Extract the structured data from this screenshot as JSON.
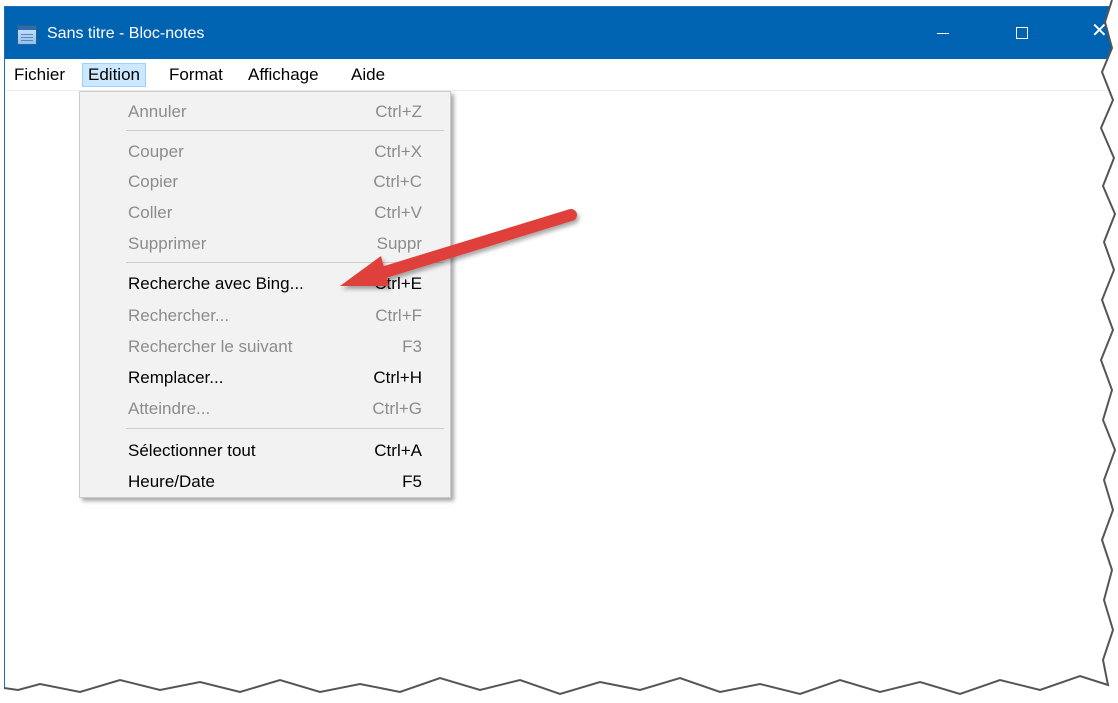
{
  "window": {
    "title": "Sans titre - Bloc-notes",
    "close_glyph": "✕"
  },
  "menubar": {
    "items": [
      {
        "label": "Fichier"
      },
      {
        "label": "Edition",
        "active": true
      },
      {
        "label": "Format"
      },
      {
        "label": "Affichage"
      },
      {
        "label": "Aide"
      }
    ]
  },
  "edit_menu": {
    "items": [
      {
        "label": "Annuler",
        "shortcut": "Ctrl+Z",
        "enabled": false
      },
      {
        "label": "Couper",
        "shortcut": "Ctrl+X",
        "enabled": false
      },
      {
        "label": "Copier",
        "shortcut": "Ctrl+C",
        "enabled": false
      },
      {
        "label": "Coller",
        "shortcut": "Ctrl+V",
        "enabled": false
      },
      {
        "label": "Supprimer",
        "shortcut": "Suppr",
        "enabled": false
      },
      {
        "label": "Recherche avec Bing...",
        "shortcut": "Ctrl+E",
        "enabled": true
      },
      {
        "label": "Rechercher...",
        "shortcut": "Ctrl+F",
        "enabled": false
      },
      {
        "label": "Rechercher le suivant",
        "shortcut": "F3",
        "enabled": false
      },
      {
        "label": "Remplacer...",
        "shortcut": "Ctrl+H",
        "enabled": true
      },
      {
        "label": "Atteindre...",
        "shortcut": "Ctrl+G",
        "enabled": false
      },
      {
        "label": "Sélectionner tout",
        "shortcut": "Ctrl+A",
        "enabled": true
      },
      {
        "label": "Heure/Date",
        "shortcut": "F5",
        "enabled": true
      }
    ]
  },
  "colors": {
    "titlebar": "#0063b1",
    "menu_bg": "#f2f2f2",
    "disabled_text": "#8c8c8c",
    "arrow": "#e0403a"
  }
}
